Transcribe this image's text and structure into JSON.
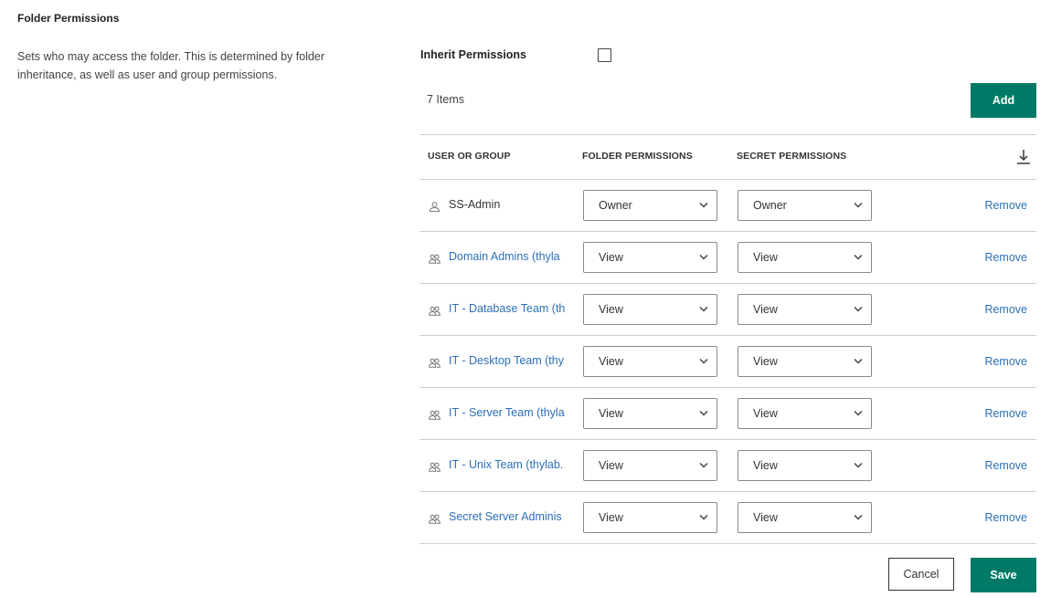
{
  "section": {
    "title": "Folder Permissions",
    "description": "Sets who may access the folder. This is determined by folder inheritance, as well as user and group permissions."
  },
  "inherit": {
    "label": "Inherit Permissions",
    "checked": false
  },
  "item_count": "7 Items",
  "add_label": "Add",
  "table": {
    "headers": {
      "user": "USER OR GROUP",
      "folder": "FOLDER PERMISSIONS",
      "secret": "SECRET PERMISSIONS"
    },
    "rows": [
      {
        "icon": "user-icon",
        "name": "SS-Admin",
        "link": false,
        "folder": "Owner",
        "secret": "Owner",
        "remove": "Remove"
      },
      {
        "icon": "group-icon",
        "name": "Domain Admins (thyla",
        "link": true,
        "folder": "View",
        "secret": "View",
        "remove": "Remove"
      },
      {
        "icon": "group-icon",
        "name": "IT - Database Team (th",
        "link": true,
        "folder": "View",
        "secret": "View",
        "remove": "Remove"
      },
      {
        "icon": "group-icon",
        "name": "IT - Desktop Team (thy",
        "link": true,
        "folder": "View",
        "secret": "View",
        "remove": "Remove"
      },
      {
        "icon": "group-icon",
        "name": "IT - Server Team (thyla",
        "link": true,
        "folder": "View",
        "secret": "View",
        "remove": "Remove"
      },
      {
        "icon": "group-icon",
        "name": "IT - Unix Team (thylab.",
        "link": true,
        "folder": "View",
        "secret": "View",
        "remove": "Remove"
      },
      {
        "icon": "group-icon",
        "name": "Secret Server Adminis",
        "link": true,
        "folder": "View",
        "secret": "View",
        "remove": "Remove"
      }
    ]
  },
  "actions": {
    "cancel": "Cancel",
    "save": "Save"
  },
  "colors": {
    "primary": "#007a66",
    "link": "#2c6fb8"
  }
}
